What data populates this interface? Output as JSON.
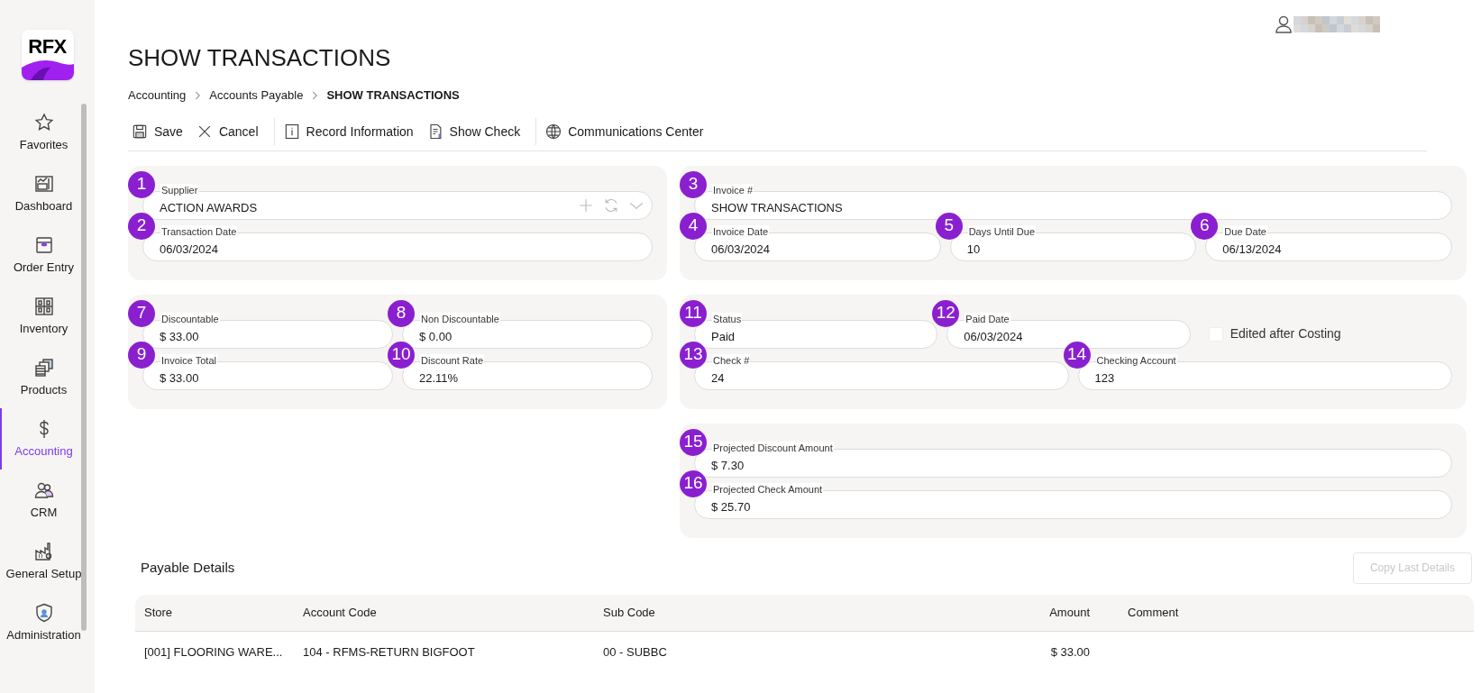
{
  "sidebar": {
    "logo": "RFX",
    "items": [
      {
        "label": "Favorites",
        "selected": false
      },
      {
        "label": "Dashboard",
        "selected": false
      },
      {
        "label": "Order Entry",
        "selected": false
      },
      {
        "label": "Inventory",
        "selected": false
      },
      {
        "label": "Products",
        "selected": false
      },
      {
        "label": "Accounting",
        "selected": true
      },
      {
        "label": "CRM",
        "selected": false
      },
      {
        "label": "General Setup",
        "selected": false
      },
      {
        "label": "Administration",
        "selected": false
      }
    ]
  },
  "header": {
    "title": "SHOW TRANSACTIONS"
  },
  "breadcrumbs": [
    {
      "label": "Accounting",
      "current": false
    },
    {
      "label": "Accounts Payable",
      "current": false
    },
    {
      "label": "SHOW TRANSACTIONS",
      "current": true
    }
  ],
  "toolbar": {
    "groups": [
      [
        "Save",
        "Cancel"
      ],
      [
        "Record Information",
        "Show Check"
      ],
      [
        "Communications Center"
      ]
    ]
  },
  "panel_rows": [
    {
      "left": {
        "rows": [
          [
            {
              "kind": "combo",
              "badge": "1",
              "label": "Supplier",
              "value": "ACTION AWARDS"
            }
          ],
          [
            {
              "kind": "text",
              "badge": "2",
              "label": "Transaction Date",
              "value": "06/03/2024"
            }
          ]
        ]
      },
      "right": {
        "rows": [
          [
            {
              "kind": "text",
              "badge": "3",
              "label": "Invoice #",
              "value": "SHOW TRANSACTIONS"
            }
          ],
          [
            {
              "kind": "text",
              "badge": "4",
              "label": "Invoice Date",
              "value": "06/03/2024"
            },
            {
              "kind": "text",
              "badge": "5",
              "label": "Days Until Due",
              "value": "10"
            },
            {
              "kind": "text",
              "badge": "6",
              "label": "Due Date",
              "value": "06/13/2024"
            }
          ]
        ]
      }
    },
    {
      "left": {
        "rows": [
          [
            {
              "kind": "text",
              "badge": "7",
              "label": "Discountable",
              "value": "$ 33.00"
            },
            {
              "kind": "text",
              "badge": "8",
              "label": "Non Discountable",
              "value": "$ 0.00"
            }
          ],
          [
            {
              "kind": "text",
              "badge": "9",
              "label": "Invoice Total",
              "value": "$ 33.00"
            },
            {
              "kind": "text",
              "badge": "10",
              "label": "Discount Rate",
              "value": "22.11%"
            }
          ]
        ]
      },
      "right": {
        "rows": [
          [
            {
              "kind": "text",
              "badge": "11",
              "label": "Status",
              "value": "Paid"
            },
            {
              "kind": "text",
              "badge": "12",
              "label": "Paid Date",
              "value": "06/03/2024"
            },
            {
              "kind": "checkbox",
              "label": "Edited after Costing",
              "checked": false
            }
          ],
          [
            {
              "kind": "text",
              "badge": "13",
              "label": "Check #",
              "value": "24"
            },
            {
              "kind": "text",
              "badge": "14",
              "label": "Checking Account",
              "value": "123"
            }
          ]
        ]
      }
    },
    {
      "right": {
        "rows": [
          [
            {
              "kind": "text",
              "badge": "15",
              "label": "Projected Discount Amount",
              "value": "$ 7.30"
            }
          ],
          [
            {
              "kind": "text",
              "badge": "16",
              "label": "Projected Check Amount",
              "value": "$ 25.70"
            }
          ]
        ]
      }
    }
  ],
  "payable_details": {
    "title": "Payable Details",
    "copy_button": {
      "label": "Copy Last Details",
      "disabled": true
    },
    "columns": [
      "Store",
      "Account Code",
      "Sub Code",
      "Amount",
      "Comment"
    ],
    "rows": [
      {
        "store": "[001] FLOORING WARE...",
        "account_code": "104 - RFMS-RETURN BIGFOOT",
        "sub_code": "00 - SUBBC",
        "amount": "$ 33.00"
      }
    ]
  }
}
